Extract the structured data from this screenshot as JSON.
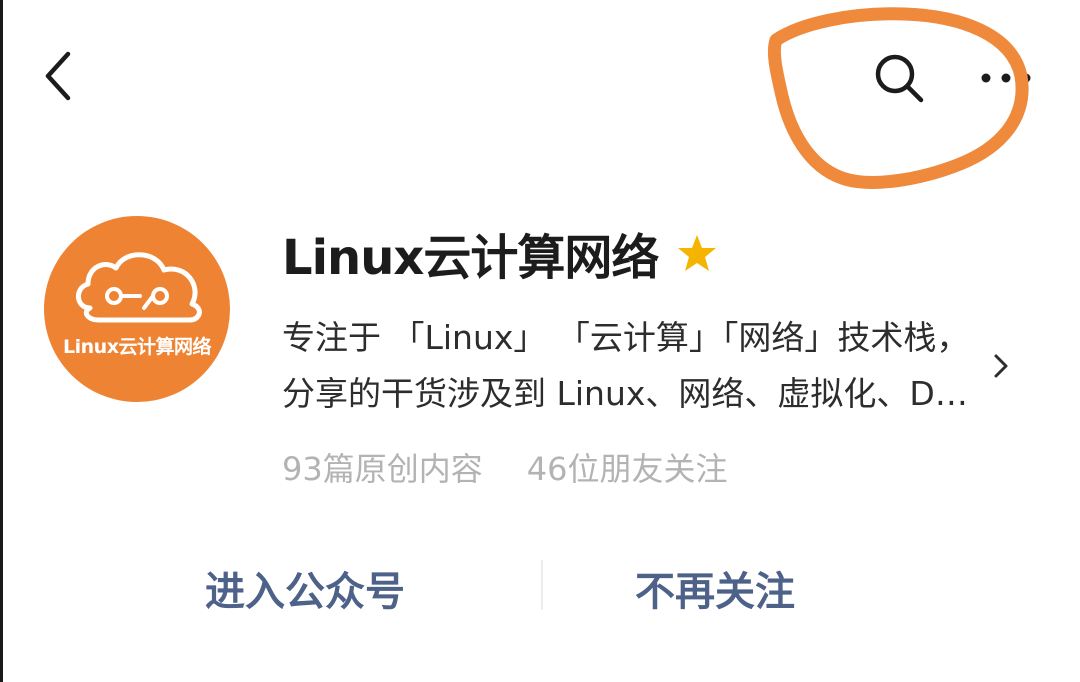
{
  "nav": {
    "back_icon": "chevron-left-icon",
    "search_icon": "search-icon",
    "more_icon": "more-dots-icon"
  },
  "account": {
    "avatar_text": "Linux云计算网络",
    "name": "Linux云计算网络",
    "badge_icon": "star-icon",
    "description": "专注于 「Linux」 「云计算」「网络」技术栈，分享的干货涉及到 Linux、网络、虚拟化、Docker、Kubernetes、SDN、Python、Go、编程等",
    "articles_count": "93篇原创内容",
    "followers_count": "46位朋友关注"
  },
  "actions": {
    "enter_label": "进入公众号",
    "unfollow_label": "不再关注"
  },
  "colors": {
    "avatar_bg": "#ee8433",
    "annotation": "#ef8a3d",
    "star": "#f5b400",
    "action_text": "#4d6189",
    "stats_text": "#b3b3b3"
  }
}
